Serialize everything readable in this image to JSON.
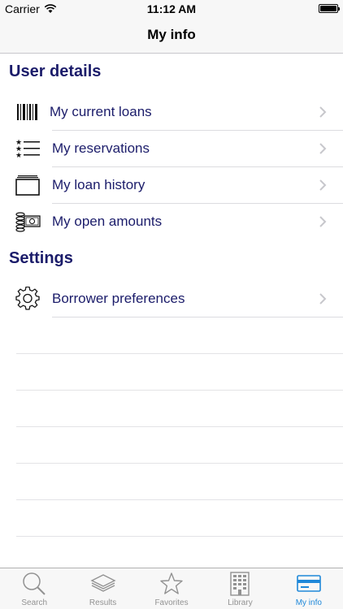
{
  "status_bar": {
    "carrier": "Carrier",
    "time": "11:12 AM"
  },
  "nav": {
    "title": "My info"
  },
  "sections": [
    {
      "title": "User details",
      "items": [
        {
          "label": "My current loans",
          "icon": "barcode-icon"
        },
        {
          "label": "My reservations",
          "icon": "list-stars-icon"
        },
        {
          "label": "My loan history",
          "icon": "stacked-folders-icon"
        },
        {
          "label": "My open amounts",
          "icon": "money-coins-icon"
        }
      ]
    },
    {
      "title": "Settings",
      "items": [
        {
          "label": "Borrower preferences",
          "icon": "gear-icon"
        }
      ]
    }
  ],
  "tabs": [
    {
      "label": "Search",
      "icon": "search-icon",
      "active": false
    },
    {
      "label": "Results",
      "icon": "stack-icon",
      "active": false
    },
    {
      "label": "Favorites",
      "icon": "star-icon",
      "active": false
    },
    {
      "label": "Library",
      "icon": "building-icon",
      "active": false
    },
    {
      "label": "My info",
      "icon": "card-icon",
      "active": true
    }
  ],
  "colors": {
    "accent": "#1e88d9",
    "label": "#1b1c6a",
    "inactive": "#929292"
  }
}
